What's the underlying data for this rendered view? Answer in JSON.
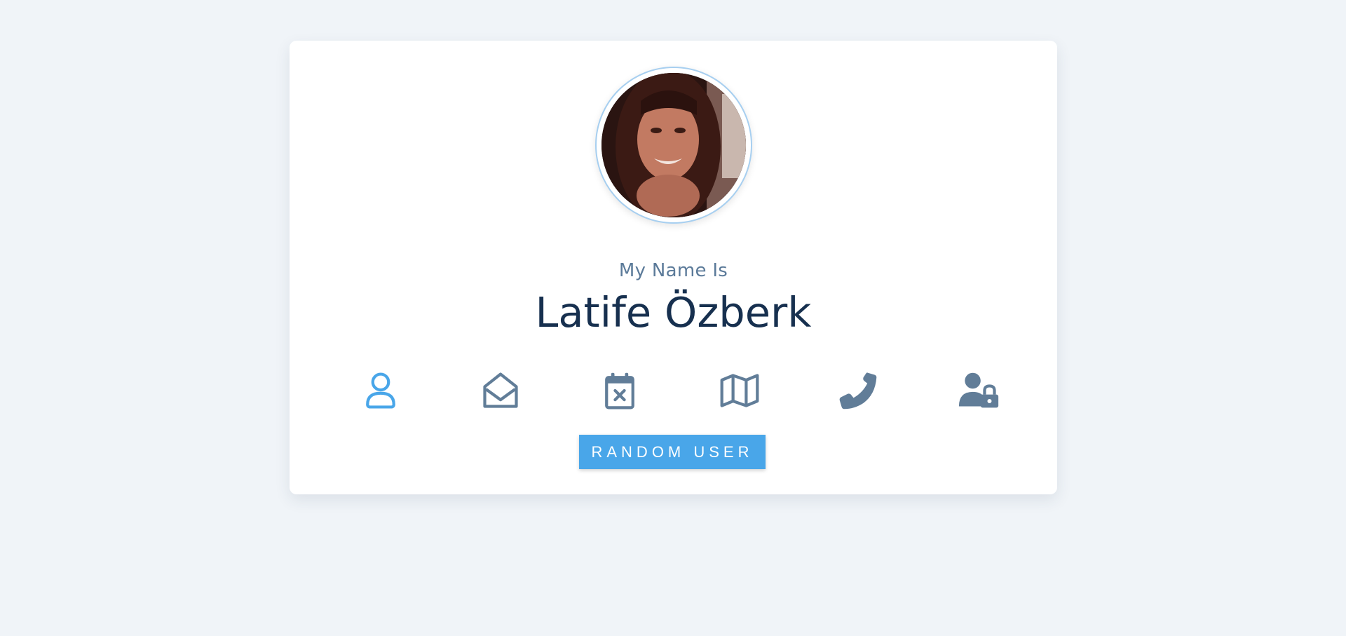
{
  "profile": {
    "label": "My Name Is",
    "value": "Latife Özberk"
  },
  "icons": [
    {
      "name": "user-icon",
      "active": true
    },
    {
      "name": "envelope-open-icon",
      "active": false
    },
    {
      "name": "calendar-times-icon",
      "active": false
    },
    {
      "name": "map-icon",
      "active": false
    },
    {
      "name": "phone-icon",
      "active": false
    },
    {
      "name": "user-lock-icon",
      "active": false
    }
  ],
  "button": {
    "label": "RANDOM USER"
  },
  "colors": {
    "background": "#f0f4f8",
    "accent": "#49a6e9",
    "icon_inactive": "#617d98",
    "name_text": "#17304f",
    "label_text": "#5b7a99"
  }
}
